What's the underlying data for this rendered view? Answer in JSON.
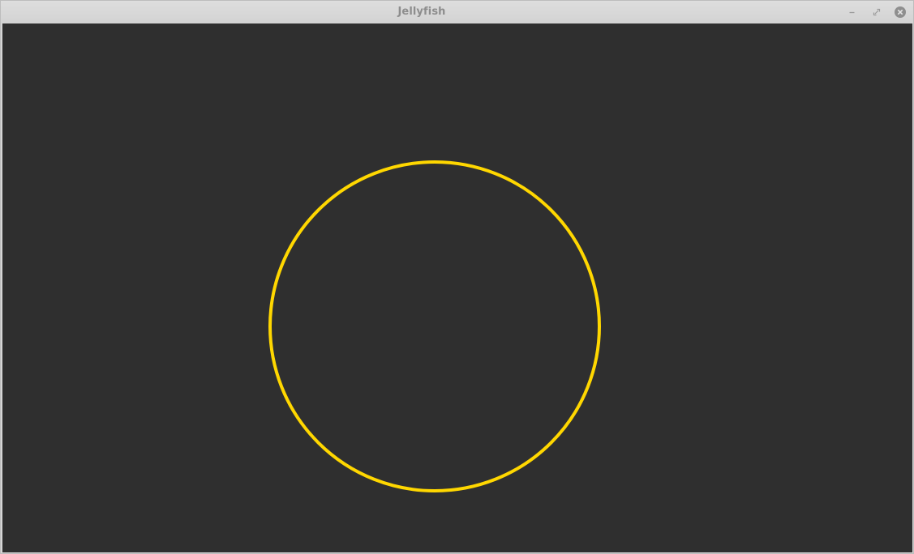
{
  "window": {
    "title": "Jellyfish",
    "controls": {
      "minimize_icon": "minimize-icon",
      "maximize_icon": "maximize-icon",
      "close_icon": "close-icon"
    }
  },
  "canvas": {
    "background_color": "#2f2f2f",
    "shape": "circle",
    "stroke_color": "#ffd700",
    "fill": "none"
  }
}
